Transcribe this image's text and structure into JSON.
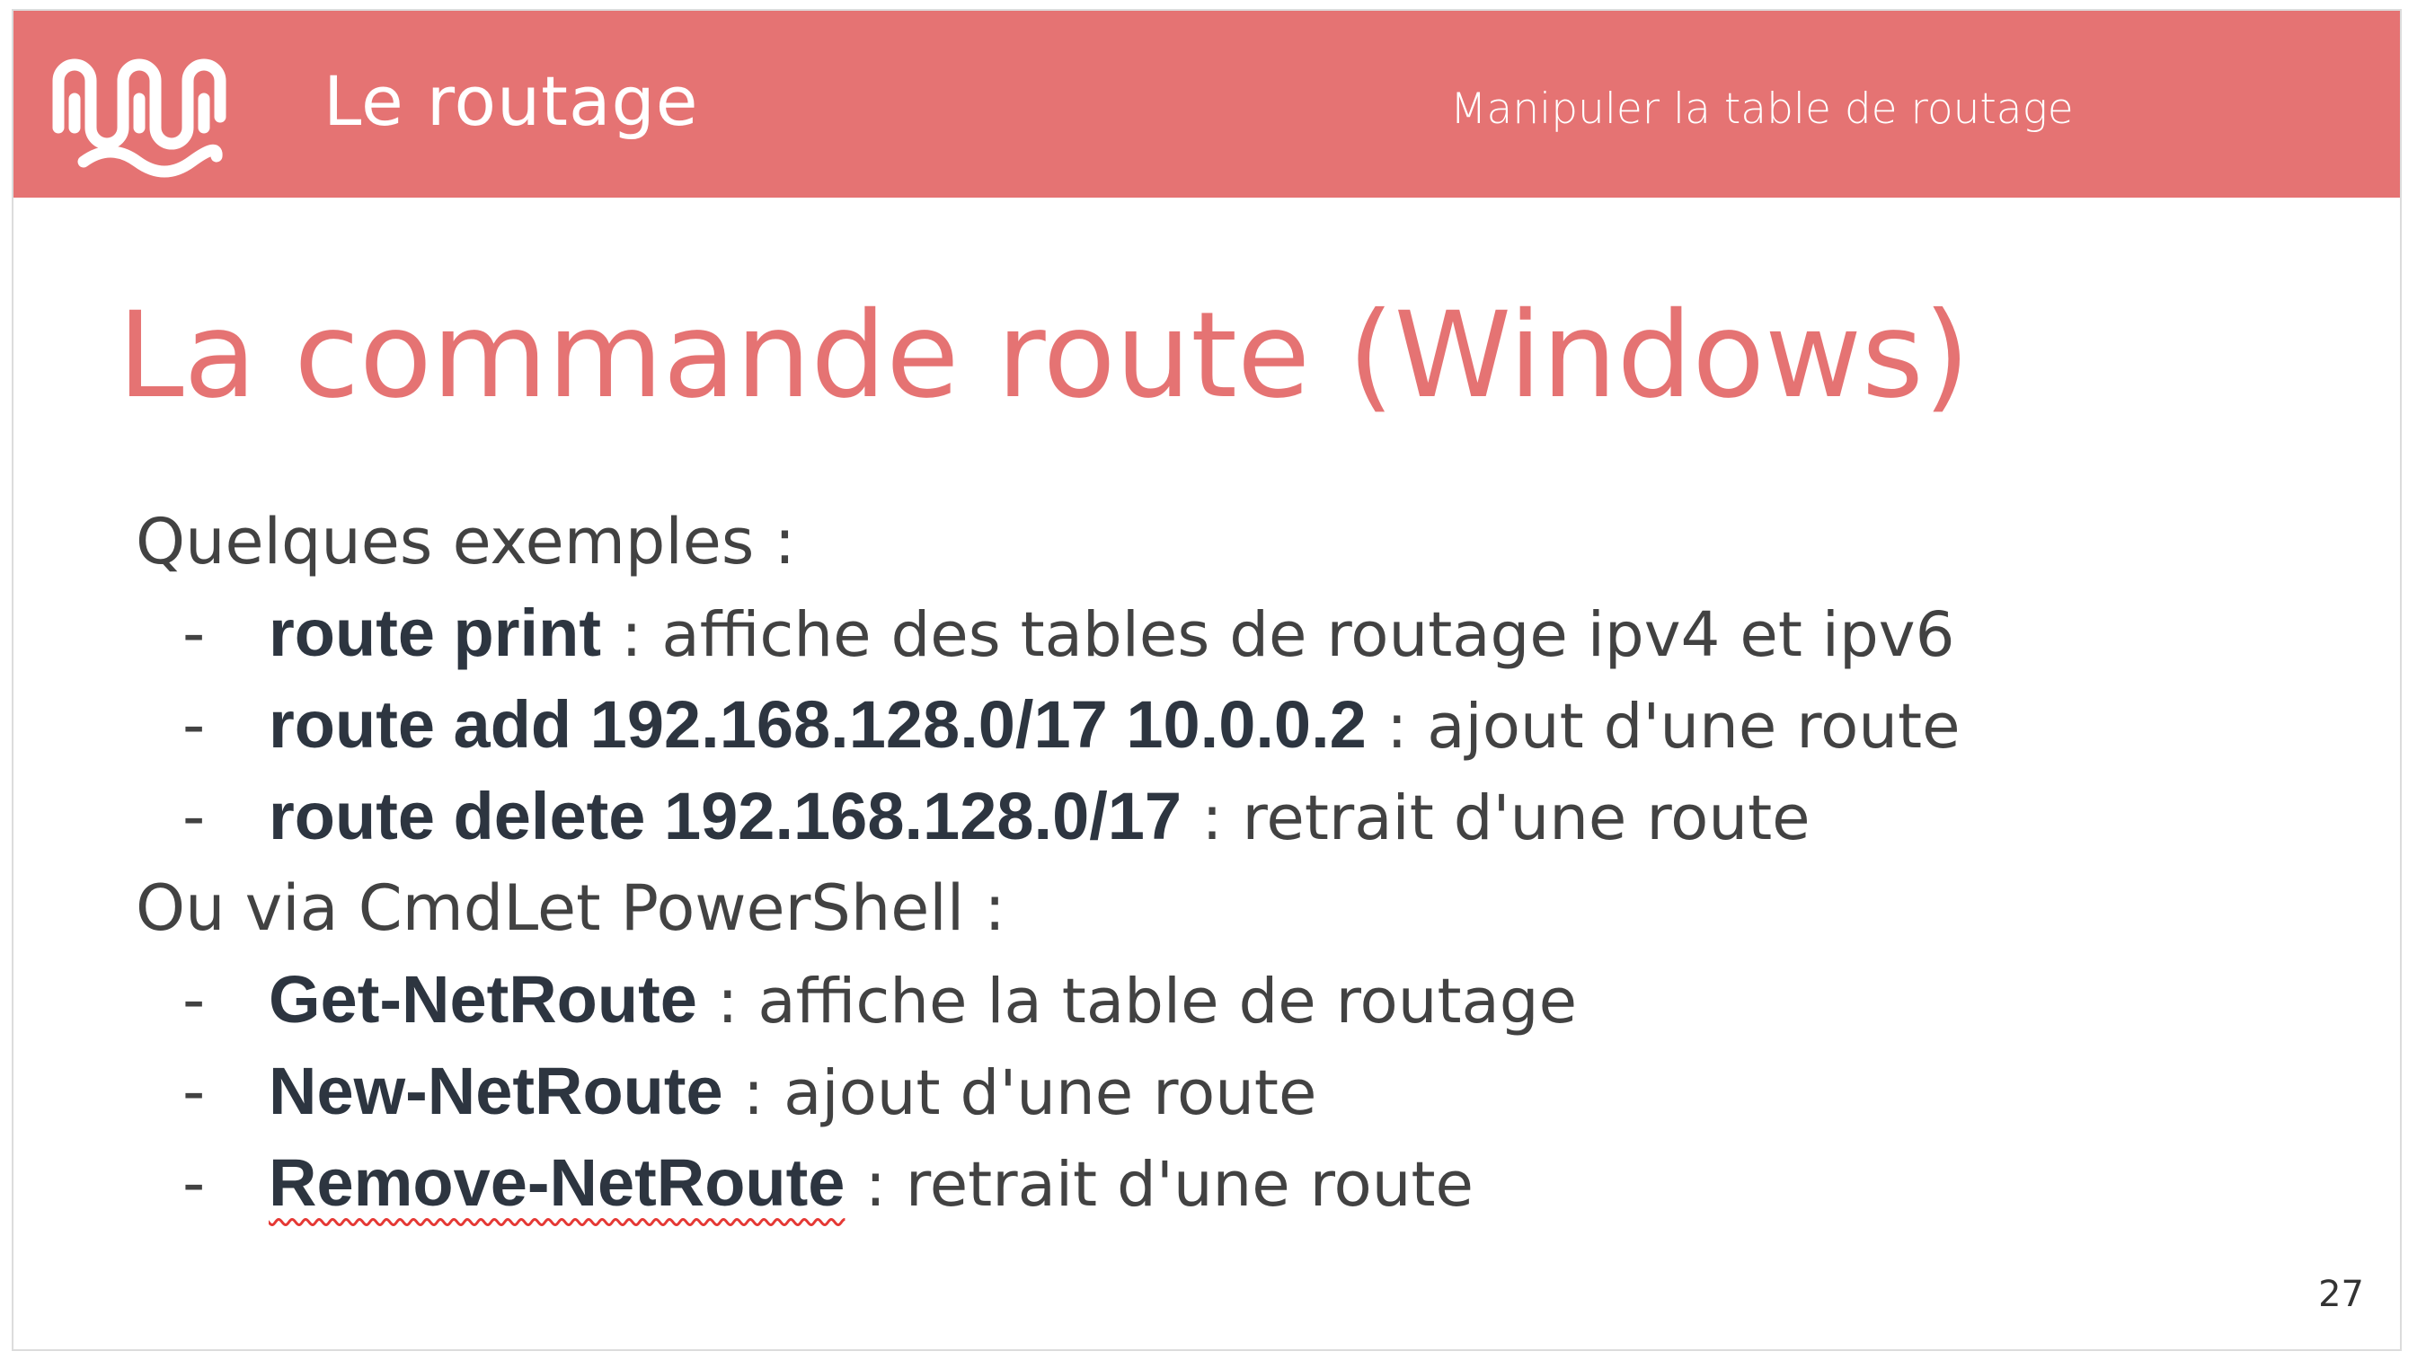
{
  "header": {
    "title": "Le routage",
    "section": "Manipuler la table de routage",
    "logo_icon": "wave-logo-icon",
    "background_color": "#e57373"
  },
  "slide": {
    "title": "La commande route (Windows)",
    "title_color": "#e57373",
    "intro_1": "Quelques exemples :",
    "route_examples": [
      {
        "command": "route print",
        "description": ": affiche des tables de routage ipv4 et ipv6"
      },
      {
        "command": "route add 192.168.128.0/17 10.0.0.2",
        "description": ": ajout d'une route"
      },
      {
        "command": "route delete 192.168.128.0/17",
        "description": ": retrait d'une route"
      }
    ],
    "intro_2": "Ou via CmdLet PowerShell :",
    "powershell_examples": [
      {
        "command": "Get-NetRoute",
        "description": ": affiche la table de routage"
      },
      {
        "command": "New-NetRoute",
        "description": ": ajout d'une route"
      },
      {
        "command": "Remove-NetRoute",
        "description": ": retrait d'une route"
      }
    ],
    "bullet_symbol": "-",
    "page_number": "27"
  }
}
